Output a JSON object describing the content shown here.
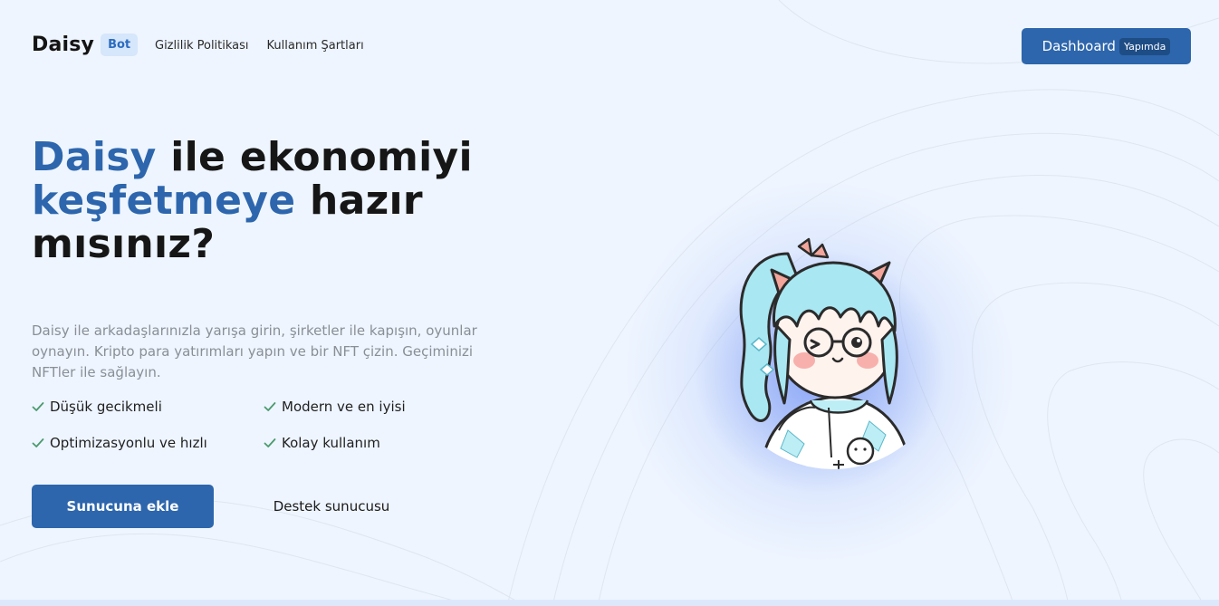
{
  "nav": {
    "brand_name": "Daisy",
    "brand_badge": "Bot",
    "links": [
      "Gizlilik Politikası",
      "Kullanım Şartları"
    ],
    "dashboard_label": "Dashboard",
    "dashboard_tag": "Yapımda"
  },
  "hero": {
    "title_parts": [
      "Daisy",
      " ile ekonomiyi ",
      "keşfetmeye",
      " hazır mısınız?"
    ],
    "description": "Daisy ile arkadaşlarınızla yarışa girin, şirketler ile kapışın, oyunlar oynayın. Kripto para yatırımları yapın ve bir NFT çizin. Geçiminizi NFTler ile sağlayın.",
    "features": [
      "Düşük gecikmeli",
      "Modern ve en iyisi",
      "Optimizasyonlu ve hızlı",
      "Kolay kullanım"
    ],
    "primary_button": "Sunucuna ekle",
    "secondary_button": "Destek sunucusu"
  },
  "colors": {
    "accent": "#2d66ac",
    "background": "#eef5ff",
    "check": "#4a9a6e"
  },
  "icons": {
    "feature_icon": "check-icon"
  }
}
